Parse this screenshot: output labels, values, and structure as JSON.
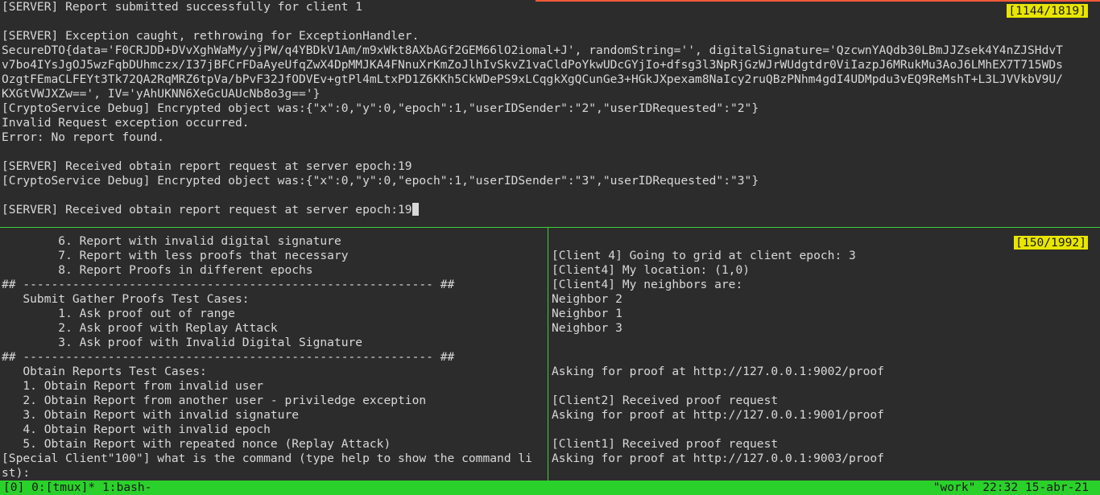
{
  "top_pane": {
    "counter": "[1144/1819]",
    "lines": [
      "[SERVER] Report submitted successfully for client 1",
      "",
      "[SERVER] Exception caught, rethrowing for ExceptionHandler.",
      "SecureDTO{data='F0CRJDD+DVvXghWaMy/yjPW/q4YBDkV1Am/m9xWkt8AXbAGf2GEM66lO2iomal+J', randomString='', digitalSignature='QzcwnYAQdb30LBmJJZsek4Y4nZJSHdvT",
      "v7bo4IYsJgOJ5wzFqbDUhmczx/I37jBFCrFDaAyeUfqZwX4DpMMJKA4FNnuXrKmZoJlhIvSkvZ1vaCldPoYkwUDcGYjIo+dfsg3l3NpRjGzWJrWUdgtdr0ViIazpJ6MRukMu3AoJ6LMhEX7T715WDs",
      "OzgtFEmaCLFEYt3Tk72QA2RqMRZ6tpVa/bPvF32JfODVEv+gtPl4mLtxPD1Z6KKh5CkWDePS9xLCqgkXgQCunGe3+HGkJXpexam8NaIcy2ruQBzPNhm4gdI4UDMpdu3vEQ9ReMshT+L3LJVVkbV9U/",
      "KXGtVWJXZw==', IV='yAhUKNN6XeGcUAUcNb8o3g=='}",
      "[CryptoService Debug] Encrypted object was:{\"x\":0,\"y\":0,\"epoch\":1,\"userIDSender\":\"2\",\"userIDRequested\":\"2\"}",
      "Invalid Request exception occurred.",
      "Error: No report found.",
      "",
      "[SERVER] Received obtain report request at server epoch:19",
      "[CryptoService Debug] Encrypted object was:{\"x\":0,\"y\":0,\"epoch\":1,\"userIDSender\":\"3\",\"userIDRequested\":\"3\"}",
      "",
      "[SERVER] Received obtain report request at server epoch:19"
    ]
  },
  "left_pane": {
    "lines": [
      "        6. Report with invalid digital signature",
      "        7. Report with less proofs that necessary",
      "        8. Report Proofs in different epochs",
      "## ---------------------------------------------------------- ##",
      "   Submit Gather Proofs Test Cases:",
      "        1. Ask proof out of range",
      "        2. Ask proof with Replay Attack",
      "        3. Ask proof with Invalid Digital Signature",
      "## ---------------------------------------------------------- ##",
      "   Obtain Reports Test Cases:",
      "   1. Obtain Report from invalid user",
      "   2. Obtain Report from another user - priviledge exception",
      "   3. Obtain Report with invalid signature",
      "   4. Obtain Report with invalid epoch",
      "   5. Obtain Report with repeated nonce (Replay Attack)",
      "[Special Client\"100\"] what is the command (type help to show the command li",
      "st):"
    ]
  },
  "right_pane": {
    "counter": "[150/1992]",
    "lines": [
      "",
      "[Client 4] Going to grid at client epoch: 3",
      "[Client4] My location: (1,0)",
      "[Client4] My neighbors are:",
      "Neighbor 2",
      "Neighbor 1",
      "Neighbor 3",
      "",
      "",
      "Asking for proof at http://127.0.0.1:9002/proof",
      "",
      "[Client2] Received proof request",
      "Asking for proof at http://127.0.0.1:9001/proof",
      "",
      "[Client1] Received proof request",
      "Asking for proof at http://127.0.0.1:9003/proof"
    ]
  },
  "status_bar": {
    "left": "[0] 0:[tmux]* 1:bash-",
    "right": "\"work\" 22:32 15-abr-21"
  },
  "colors": {
    "background": "#2c2c2c",
    "text": "#d8d8d8",
    "status_bar": "#2bd12b",
    "pane_border": "#3fd13a",
    "counter_badge": "#e8e600",
    "active_top_border": "#f05a3a"
  }
}
